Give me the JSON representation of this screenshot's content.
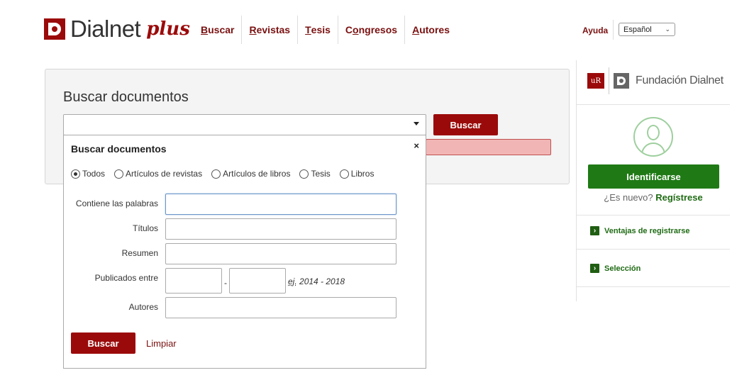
{
  "header": {
    "logo_text": "Dialnet",
    "logo_plus": "plus",
    "nav": [
      {
        "first": "B",
        "rest": "uscar"
      },
      {
        "first": "R",
        "rest": "evistas"
      },
      {
        "first": "T",
        "rest": "esis"
      },
      {
        "pre": "C",
        "first": "o",
        "rest": "ngresos"
      },
      {
        "first": "A",
        "rest": "utores"
      }
    ],
    "help": "Ayuda",
    "language": "Español"
  },
  "search": {
    "title": "Buscar documentos",
    "main_value": "",
    "button": "Buscar"
  },
  "advanced": {
    "title": "Buscar documentos",
    "close": "×",
    "types": [
      {
        "label": "Todos",
        "selected": true
      },
      {
        "label": "Artículos de revistas",
        "selected": false
      },
      {
        "label": "Artículos de libros",
        "selected": false
      },
      {
        "label": "Tesis",
        "selected": false
      },
      {
        "label": "Libros",
        "selected": false
      }
    ],
    "fields": {
      "contains": "Contiene las palabras",
      "titles": "Títulos",
      "summary": "Resumen",
      "published": "Publicados entre",
      "authors": "Autores"
    },
    "range_dash": "-",
    "hint_ej": "ej.",
    "hint_range": " 2014 - 2018",
    "submit": "Buscar",
    "clear": "Limpiar"
  },
  "sidebar": {
    "foundation": "Fundación Dialnet",
    "foundation_mark": "uR",
    "login": "Identificarse",
    "new_q": "¿Es nuevo? ",
    "register": "Regístrese",
    "links": [
      "Ventajas de registrarse",
      "Selección"
    ]
  },
  "colors": {
    "brand": "#9b0a0a",
    "green": "#1f7a15"
  }
}
